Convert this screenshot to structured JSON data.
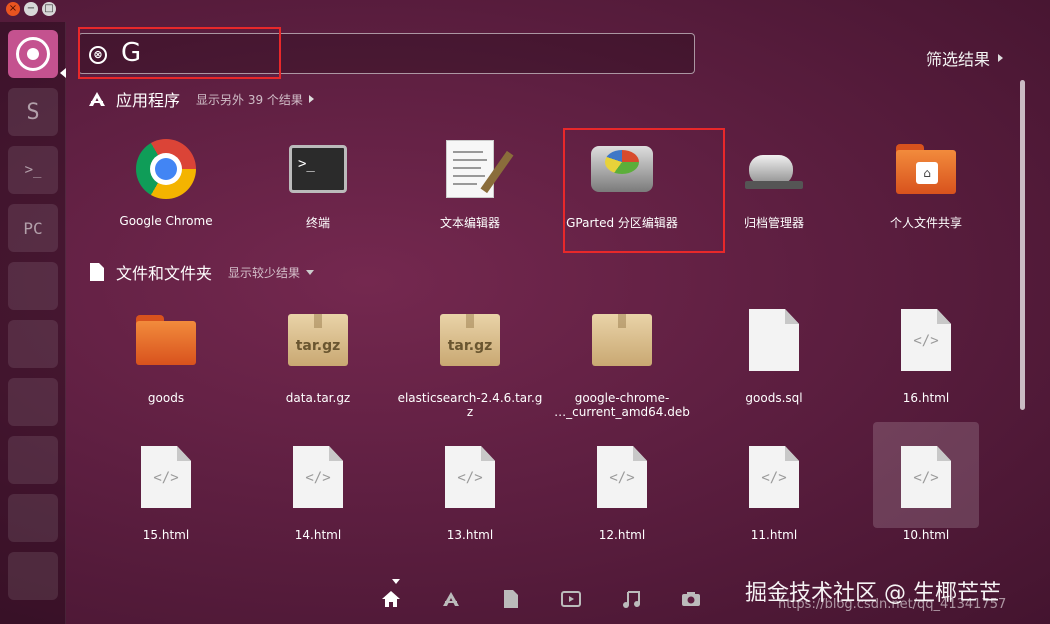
{
  "window": {
    "close": "×",
    "minimize": "−",
    "maximize": "□"
  },
  "search": {
    "query": "G",
    "clear_icon": "⊗"
  },
  "filter": {
    "label": "筛选结果"
  },
  "sections": {
    "apps": {
      "title": "应用程序",
      "more": "显示另外 39 个结果"
    },
    "files": {
      "title": "文件和文件夹",
      "more": "显示较少结果"
    }
  },
  "apps": [
    {
      "label": "Google Chrome",
      "icon": "chrome-icon"
    },
    {
      "label": "终端",
      "icon": "terminal-icon"
    },
    {
      "label": "文本编辑器",
      "icon": "text-editor-icon"
    },
    {
      "label": "GParted 分区编辑器",
      "icon": "gparted-icon"
    },
    {
      "label": "归档管理器",
      "icon": "archive-manager-icon"
    },
    {
      "label": "个人文件共享",
      "icon": "file-share-icon"
    }
  ],
  "files_row1": [
    {
      "label": "goods",
      "icon": "folder-icon"
    },
    {
      "label": "data.tar.gz",
      "icon": "archive-file-icon",
      "badge": "tar.gz"
    },
    {
      "label": "elasticsearch-2.4.6.tar.g\nz",
      "icon": "archive-file-icon",
      "badge": "tar.gz"
    },
    {
      "label": "google-chrome-\n…_current_amd64.deb",
      "icon": "package-icon"
    },
    {
      "label": "goods.sql",
      "icon": "document-icon"
    },
    {
      "label": "16.html",
      "icon": "html-file-icon",
      "glyph": "</>"
    }
  ],
  "files_row2": [
    {
      "label": "15.html",
      "glyph": "</>"
    },
    {
      "label": "14.html",
      "glyph": "</>"
    },
    {
      "label": "13.html",
      "glyph": "</>"
    },
    {
      "label": "12.html",
      "glyph": "</>"
    },
    {
      "label": "11.html",
      "glyph": "</>"
    },
    {
      "label": "10.html",
      "glyph": "</>"
    }
  ],
  "launcher": {
    "terminal_glyph": ">_",
    "pycharm_glyph": "PC",
    "sublime_glyph": "S"
  },
  "terminal_glyph": ">_",
  "share_glyph": "⌂",
  "lenses": [
    "home-lens-icon",
    "apps-lens-icon",
    "files-lens-icon",
    "video-lens-icon",
    "music-lens-icon",
    "photo-lens-icon"
  ],
  "watermark": {
    "main": "掘金技术社区 @ 生椰芒芒",
    "url": "https://blog.csdn.net/qq_41341757"
  },
  "colors": {
    "accent": "#c4528f",
    "annotation": "#e8282a",
    "background": "#5e1f41"
  }
}
